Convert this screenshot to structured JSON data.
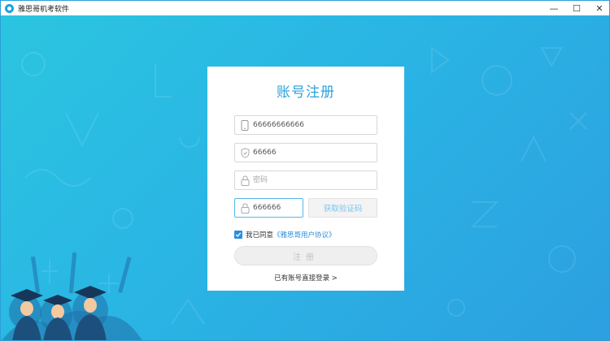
{
  "window": {
    "title": "雅思哥机考软件",
    "minimize": "—",
    "maximize": "☐",
    "close": "✕"
  },
  "register": {
    "title": "账号注册",
    "phone_value": "66666666666",
    "phone_icon": "phone-icon",
    "code_value": "66666",
    "code_icon": "shield-icon",
    "password_placeholder": "密码",
    "password_icon": "lock-icon",
    "confirm_value": "666666",
    "confirm_icon": "lock-icon",
    "get_code_label": "获取验证码",
    "agree_checked": true,
    "agree_text": "我已同意",
    "agree_link": "《雅思哥用户协议》",
    "submit_label": "注册",
    "login_link": "已有账号直接登录 >"
  },
  "colors": {
    "accent": "#2aa2dc",
    "background_start": "#2bc5e0",
    "background_end": "#2c9fe0",
    "link": "#2a8fdc"
  }
}
